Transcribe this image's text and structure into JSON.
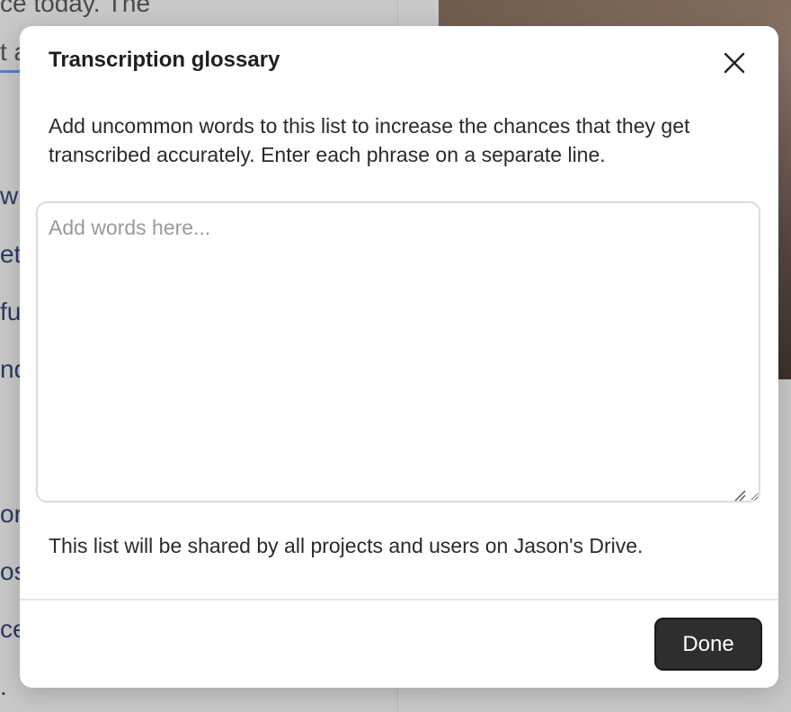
{
  "background": {
    "editor_top_text": "ce today. The",
    "editor_fragments": [
      "t a",
      "wi",
      "etv",
      "fu",
      "nd",
      "or",
      "os",
      "ce",
      "."
    ]
  },
  "dialog": {
    "title": "Transcription glossary",
    "close_icon": "close-icon",
    "description": "Add uncommon words to this list to increase the chances that they get transcribed accurately. Enter each phrase on a separate line.",
    "input": {
      "placeholder": "Add words here...",
      "value": ""
    },
    "shared_note": "This list will be shared by all projects and users on Jason's Drive.",
    "done_label": "Done"
  },
  "colors": {
    "done_button": "#2e2e2e",
    "editor_text": "#2a3a66",
    "underline": "#5b7fc2"
  }
}
